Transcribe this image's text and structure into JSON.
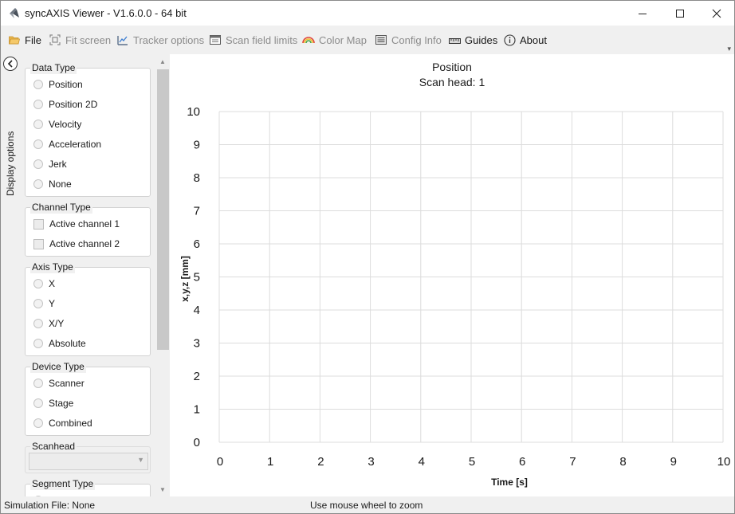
{
  "window": {
    "title": "syncAXIS Viewer - V1.6.0.0 - 64 bit"
  },
  "toolbar": {
    "items": [
      {
        "label": "File",
        "icon": "folder-icon",
        "enabled": true
      },
      {
        "label": "Fit screen",
        "icon": "fit-screen-icon",
        "enabled": false
      },
      {
        "label": "Tracker options",
        "icon": "tracker-icon",
        "enabled": false
      },
      {
        "label": "Scan field limits",
        "icon": "scan-field-icon",
        "enabled": false
      },
      {
        "label": "Color Map",
        "icon": "rainbow-icon",
        "enabled": false
      },
      {
        "label": "Config Info",
        "icon": "list-icon",
        "enabled": false
      },
      {
        "label": "Guides",
        "icon": "ruler-icon",
        "enabled": true
      },
      {
        "label": "About",
        "icon": "info-icon",
        "enabled": true
      }
    ]
  },
  "sidebar": {
    "collapse_label": "Display options",
    "groups": {
      "data_type": {
        "title": "Data Type",
        "options": [
          "Position",
          "Position 2D",
          "Velocity",
          "Acceleration",
          "Jerk",
          "None"
        ]
      },
      "channel_type": {
        "title": "Channel Type",
        "options": [
          "Active channel 1",
          "Active channel 2"
        ]
      },
      "axis_type": {
        "title": "Axis Type",
        "options": [
          "X",
          "Y",
          "X/Y",
          "Absolute"
        ]
      },
      "device_type": {
        "title": "Device Type",
        "options": [
          "Scanner",
          "Stage",
          "Combined"
        ]
      },
      "scanhead": {
        "title": "Scanhead",
        "value": ""
      },
      "segment_type": {
        "title": "Segment Type"
      }
    }
  },
  "chart_data": {
    "type": "line",
    "title": "Position",
    "subtitle": "Scan head: 1",
    "xlabel": "Time [s]",
    "ylabel": "x,y,z [mm]",
    "xlim": [
      0,
      10
    ],
    "ylim": [
      0,
      10
    ],
    "x_ticks": [
      "0",
      "1",
      "2",
      "3",
      "4",
      "5",
      "6",
      "7",
      "8",
      "9",
      "10"
    ],
    "y_ticks": [
      "0",
      "1",
      "2",
      "3",
      "4",
      "5",
      "6",
      "7",
      "8",
      "9",
      "10"
    ],
    "grid": true,
    "series": [],
    "colors": {
      "grid": "#dcdcdc"
    }
  },
  "statusbar": {
    "file": "Simulation File: None",
    "hint": "Use mouse wheel to zoom"
  }
}
